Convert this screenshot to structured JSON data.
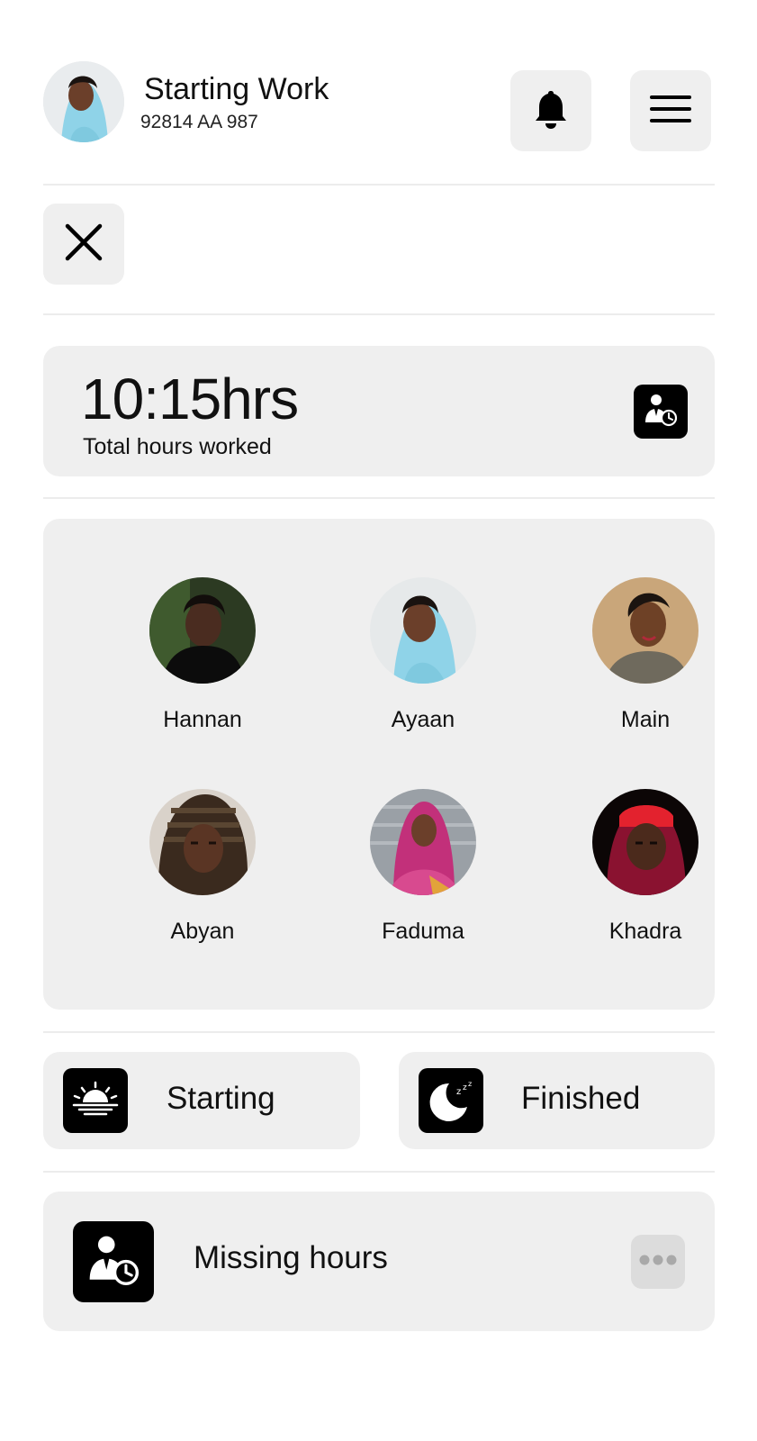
{
  "header": {
    "title": "Starting Work",
    "subtitle": "92814 AA 987",
    "notifications_icon": "bell-icon",
    "menu_icon": "hamburger-menu-icon"
  },
  "close": {
    "icon": "close-icon"
  },
  "hours": {
    "value": "10:15hrs",
    "label": "Total hours worked",
    "icon": "worker-clock-icon"
  },
  "team": {
    "members": [
      {
        "name": "Hannan"
      },
      {
        "name": "Ayaan"
      },
      {
        "name": "Main"
      },
      {
        "name": "Abyan"
      },
      {
        "name": "Faduma"
      },
      {
        "name": "Khadra"
      }
    ]
  },
  "actions": {
    "starting": {
      "label": "Starting",
      "icon": "sunrise-icon"
    },
    "finished": {
      "label": "Finished",
      "icon": "moon-sleep-icon"
    }
  },
  "missing": {
    "label": "Missing hours",
    "icon": "worker-clock-icon",
    "more_icon": "more-dots-icon"
  },
  "colors": {
    "background": "#ffffff",
    "card": "#efefef",
    "tile": "#000000",
    "divider": "#ececec",
    "more_button": "#dcdcdc"
  }
}
